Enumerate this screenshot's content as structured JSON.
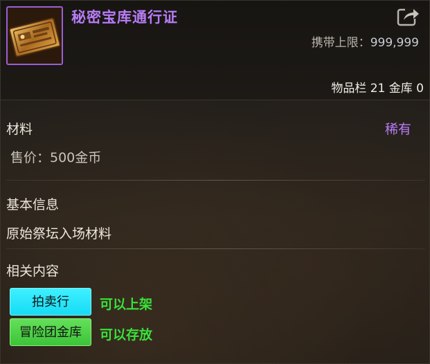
{
  "item": {
    "name": "秘密宝库通行证",
    "carry_limit_label": "携带上限：",
    "carry_limit_value": "999,999",
    "storage_text": "物品栏 21 金库 0",
    "category": "材料",
    "rarity": "稀有",
    "price": "售价：500金币"
  },
  "basic_info": {
    "title": "基本信息",
    "description": "原始祭坛入场材料"
  },
  "related": {
    "title": "相关内容",
    "tags": [
      {
        "button": "拍卖行",
        "status": "可以上架"
      },
      {
        "button": "冒险团金库",
        "status": "可以存放"
      }
    ]
  },
  "colors": {
    "rarity_purple": "#b77cf5",
    "auction_cyan": "#15dcf5",
    "guild_green": "#3cc338",
    "status_green": "#39e23a"
  },
  "icons": {
    "item_icon": "golden-pass-ticket-icon",
    "share_icon": "share-export-icon"
  }
}
